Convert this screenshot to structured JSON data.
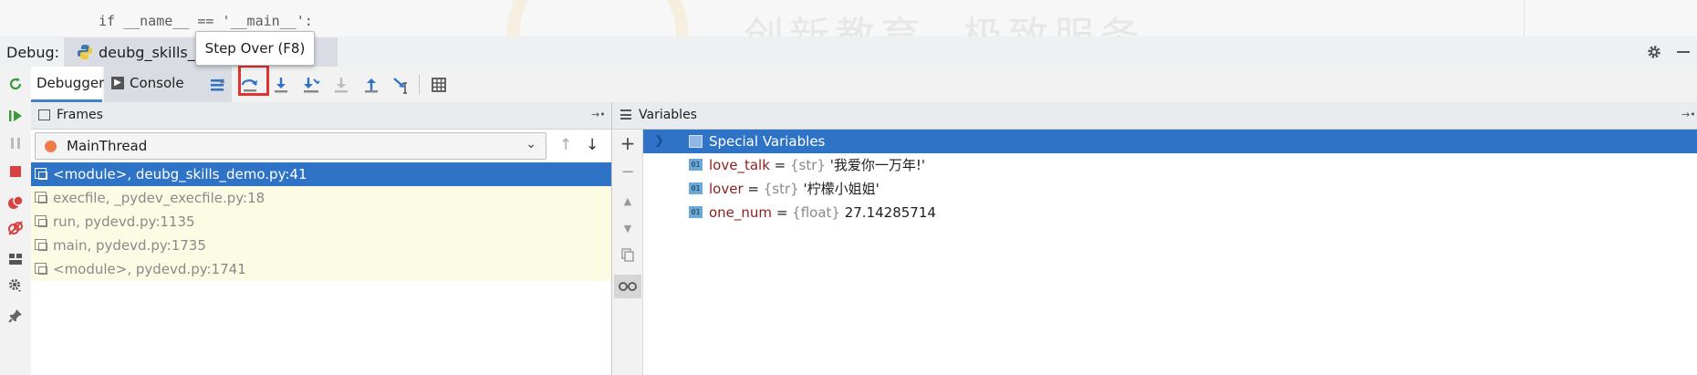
{
  "editor": {
    "code_line": "if __name__ == '__main__':",
    "watermark": "创新教育  极致服务"
  },
  "debug_header": {
    "label": "Debug:",
    "session_tab": "deubg_skills_d"
  },
  "tooltip": {
    "text": "Step Over (F8)"
  },
  "tabs": {
    "debugger": "Debugger",
    "console": "Console"
  },
  "toolbar_icons": [
    "show-execution-point-icon",
    "step-over-icon",
    "step-into-icon",
    "step-into-my-code-icon",
    "force-step-into-icon",
    "step-out-icon",
    "run-to-cursor-icon",
    "evaluate-expression-icon"
  ],
  "frames": {
    "title": "Frames",
    "thread": "MainThread",
    "items": [
      {
        "text": "<module>, deubg_skills_demo.py:41",
        "state": "selected"
      },
      {
        "text": "execfile, _pydev_execfile.py:18",
        "state": "library"
      },
      {
        "text": "run, pydevd.py:1135",
        "state": "library"
      },
      {
        "text": "main, pydevd.py:1735",
        "state": "library"
      },
      {
        "text": "<module>, pydevd.py:1741",
        "state": "library"
      }
    ]
  },
  "variables": {
    "title": "Variables",
    "special": "Special Variables",
    "items": [
      {
        "name": "love_talk",
        "eq": " = ",
        "type": "{str}",
        "value": " '我爱你一万年!'"
      },
      {
        "name": "lover",
        "eq": " = ",
        "type": "{str}",
        "value": " '柠檬小姐姐'"
      },
      {
        "name": "one_num",
        "eq": " = ",
        "type": "{float}",
        "value": " 27.14285714285714"
      }
    ],
    "type_badge": "01"
  },
  "colors": {
    "selection": "#2f73c7",
    "library_frame_bg": "#fcfbe3",
    "highlight_box": "#e23333",
    "var_name": "#8e1e1e"
  }
}
